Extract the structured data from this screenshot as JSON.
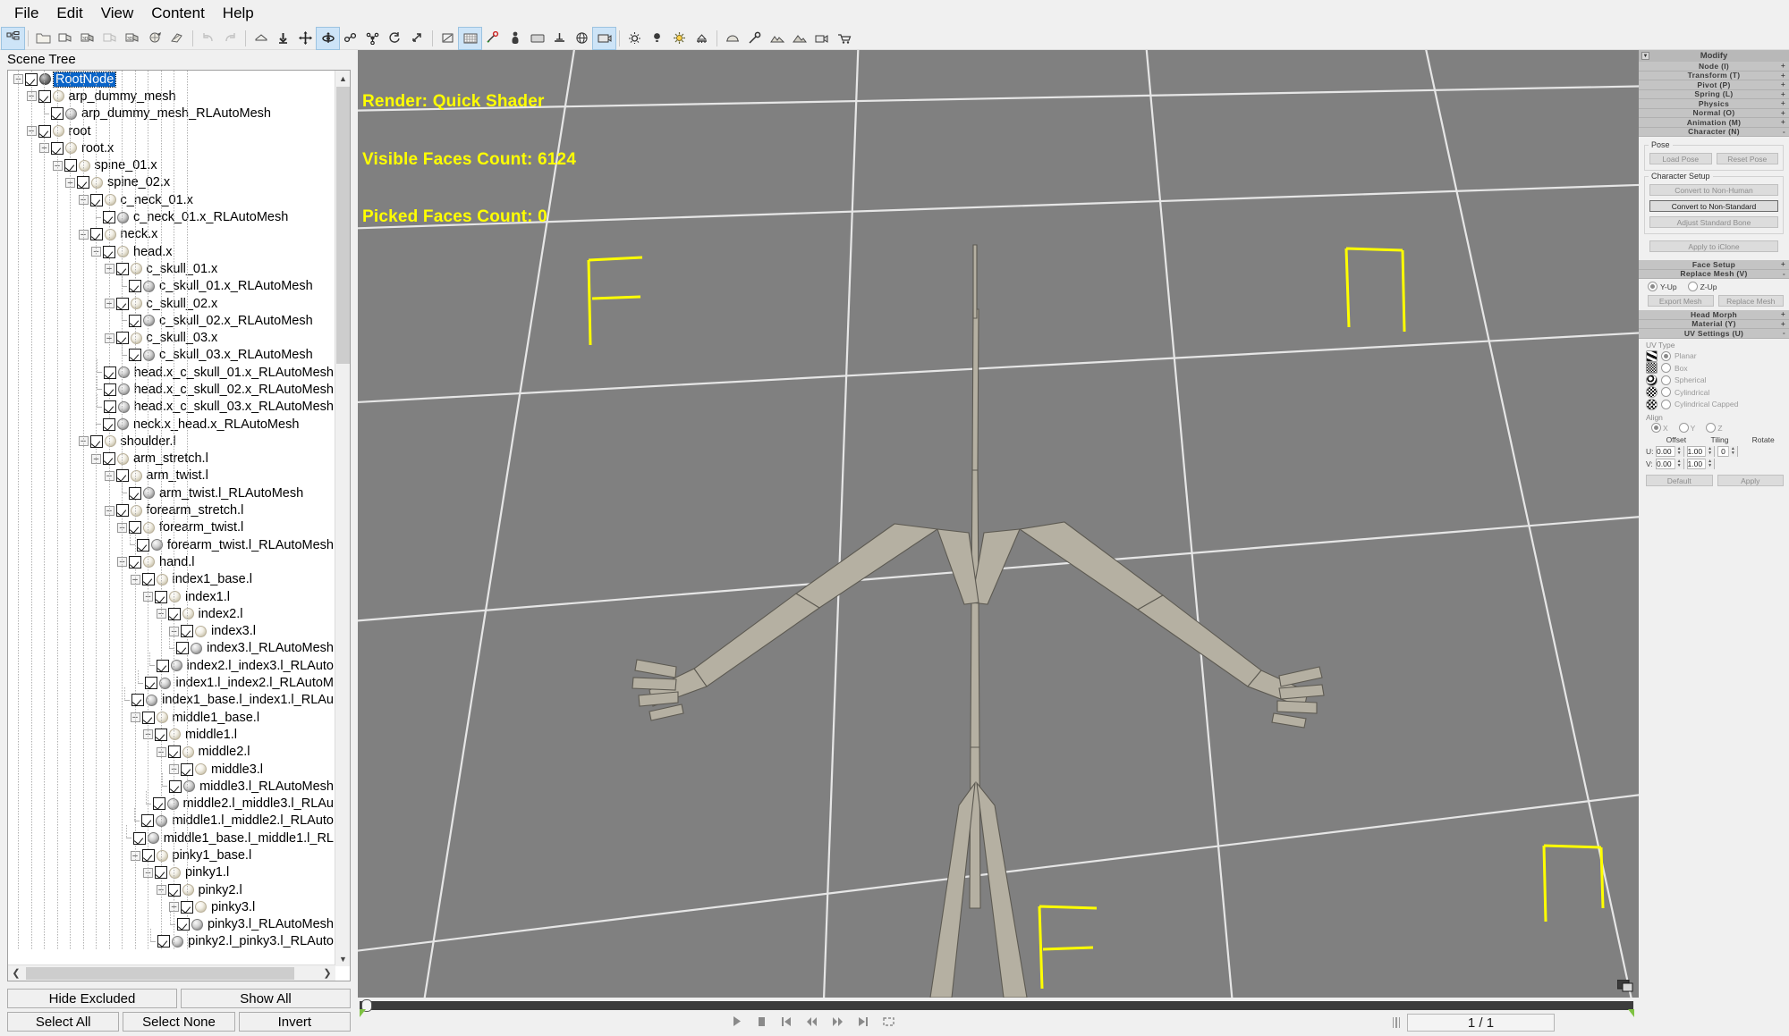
{
  "menu": {
    "items": [
      "File",
      "Edit",
      "View",
      "Content",
      "Help"
    ]
  },
  "toolbar": {
    "groups": [
      {
        "items": [
          {
            "name": "scene-tree-toggle-icon",
            "state": "active"
          }
        ]
      },
      {
        "items": [
          {
            "name": "open-folder-icon",
            "state": "normal"
          },
          {
            "name": "import-fbx-icon",
            "state": "normal"
          },
          {
            "name": "import-obj-icon",
            "state": "normal"
          },
          {
            "name": "import-bvh-icon",
            "state": "disabled"
          },
          {
            "name": "import-3ds-icon",
            "state": "normal"
          },
          {
            "name": "export-model-icon",
            "state": "normal"
          },
          {
            "name": "export-motion-icon",
            "state": "normal"
          }
        ]
      },
      {
        "items": [
          {
            "name": "undo-icon",
            "state": "disabled"
          },
          {
            "name": "redo-icon",
            "state": "disabled"
          }
        ]
      },
      {
        "items": [
          {
            "name": "home-view-icon",
            "state": "normal"
          },
          {
            "name": "drop-to-floor-icon",
            "state": "normal"
          },
          {
            "name": "move-tool-icon",
            "state": "normal"
          },
          {
            "name": "rotate-tool-icon",
            "state": "active"
          },
          {
            "name": "scale-tool-icon",
            "state": "normal"
          },
          {
            "name": "uniform-scale-icon",
            "state": "normal"
          },
          {
            "name": "reset-transform-icon",
            "state": "normal"
          },
          {
            "name": "maximize-view-icon",
            "state": "normal"
          }
        ]
      },
      {
        "items": [
          {
            "name": "wireframe-icon",
            "state": "normal"
          },
          {
            "name": "grid-toggle-icon",
            "state": "active"
          },
          {
            "name": "bone-display-icon",
            "state": "normal"
          },
          {
            "name": "character-icon",
            "state": "normal"
          },
          {
            "name": "background-icon",
            "state": "normal"
          },
          {
            "name": "ground-shadow-icon",
            "state": "normal"
          },
          {
            "name": "sphere-preview-icon",
            "state": "normal"
          },
          {
            "name": "preview-camera-icon",
            "state": "active"
          }
        ]
      },
      {
        "items": [
          {
            "name": "ambient-light-icon",
            "state": "normal"
          },
          {
            "name": "point-light-icon",
            "state": "normal"
          },
          {
            "name": "spot-light-icon",
            "state": "normal"
          },
          {
            "name": "ibl-light-icon",
            "state": "normal"
          }
        ]
      },
      {
        "items": [
          {
            "name": "props-icon",
            "state": "normal"
          },
          {
            "name": "tools-icon",
            "state": "normal"
          },
          {
            "name": "terrain-icon",
            "state": "normal"
          },
          {
            "name": "terrain2-icon",
            "state": "normal"
          },
          {
            "name": "camera-icon",
            "state": "normal"
          },
          {
            "name": "shopping-cart-icon",
            "state": "normal"
          }
        ]
      }
    ]
  },
  "scene_tree": {
    "title": "Scene Tree",
    "selected": "RootNode",
    "nodes": [
      {
        "label": "RootNode",
        "depth": 0,
        "icon": "root",
        "expander": "minus",
        "selected": true,
        "checked": true
      },
      {
        "label": "arp_dummy_mesh",
        "depth": 1,
        "icon": "bone",
        "expander": "minus",
        "checked": true
      },
      {
        "label": "arp_dummy_mesh_RLAutoMesh",
        "depth": 2,
        "icon": "mesh",
        "expander": "leaf",
        "checked": true
      },
      {
        "label": "root",
        "depth": 1,
        "icon": "bone",
        "expander": "minus",
        "checked": true
      },
      {
        "label": "root.x",
        "depth": 2,
        "icon": "bone",
        "expander": "minus",
        "checked": true
      },
      {
        "label": "spine_01.x",
        "depth": 3,
        "icon": "bone",
        "expander": "minus",
        "checked": true
      },
      {
        "label": "spine_02.x",
        "depth": 4,
        "icon": "bone",
        "expander": "minus",
        "checked": true
      },
      {
        "label": "c_neck_01.x",
        "depth": 5,
        "icon": "bone",
        "expander": "minus",
        "checked": true
      },
      {
        "label": "c_neck_01.x_RLAutoMesh",
        "depth": 6,
        "icon": "mesh",
        "expander": "leaf",
        "checked": true
      },
      {
        "label": "neck.x",
        "depth": 5,
        "icon": "bone",
        "expander": "minus",
        "checked": true
      },
      {
        "label": "head.x",
        "depth": 6,
        "icon": "bone",
        "expander": "minus",
        "checked": true
      },
      {
        "label": "c_skull_01.x",
        "depth": 7,
        "icon": "bone",
        "expander": "minus",
        "checked": true
      },
      {
        "label": "c_skull_01.x_RLAutoMesh",
        "depth": 8,
        "icon": "mesh",
        "expander": "leaf",
        "checked": true
      },
      {
        "label": "c_skull_02.x",
        "depth": 7,
        "icon": "bone",
        "expander": "minus",
        "checked": true
      },
      {
        "label": "c_skull_02.x_RLAutoMesh",
        "depth": 8,
        "icon": "mesh",
        "expander": "leaf",
        "checked": true
      },
      {
        "label": "c_skull_03.x",
        "depth": 7,
        "icon": "bone",
        "expander": "minus",
        "checked": true
      },
      {
        "label": "c_skull_03.x_RLAutoMesh",
        "depth": 8,
        "icon": "mesh",
        "expander": "leaf",
        "checked": true
      },
      {
        "label": "head.x_c_skull_01.x_RLAutoMesh",
        "depth": 7,
        "icon": "mesh",
        "expander": "leaf",
        "checked": true
      },
      {
        "label": "head.x_c_skull_02.x_RLAutoMesh",
        "depth": 7,
        "icon": "mesh",
        "expander": "leaf",
        "checked": true
      },
      {
        "label": "head.x_c_skull_03.x_RLAutoMesh",
        "depth": 7,
        "icon": "mesh",
        "expander": "leaf",
        "checked": true
      },
      {
        "label": "neck.x_head.x_RLAutoMesh",
        "depth": 6,
        "icon": "mesh",
        "expander": "leaf",
        "checked": true
      },
      {
        "label": "shoulder.l",
        "depth": 5,
        "icon": "bone",
        "expander": "minus",
        "checked": true
      },
      {
        "label": "arm_stretch.l",
        "depth": 6,
        "icon": "bone",
        "expander": "minus",
        "checked": true
      },
      {
        "label": "arm_twist.l",
        "depth": 7,
        "icon": "bone",
        "expander": "minus",
        "checked": true
      },
      {
        "label": "arm_twist.l_RLAutoMesh",
        "depth": 8,
        "icon": "mesh",
        "expander": "leaf",
        "checked": true
      },
      {
        "label": "forearm_stretch.l",
        "depth": 7,
        "icon": "bone",
        "expander": "minus",
        "checked": true
      },
      {
        "label": "forearm_twist.l",
        "depth": 8,
        "icon": "bone",
        "expander": "minus",
        "checked": true
      },
      {
        "label": "forearm_twist.l_RLAutoMesh",
        "depth": 9,
        "icon": "mesh",
        "expander": "leaf",
        "checked": true
      },
      {
        "label": "hand.l",
        "depth": 8,
        "icon": "bone",
        "expander": "minus",
        "checked": true
      },
      {
        "label": "index1_base.l",
        "depth": 9,
        "icon": "bone",
        "expander": "minus",
        "checked": true
      },
      {
        "label": "index1.l",
        "depth": 10,
        "icon": "bone",
        "expander": "minus",
        "checked": true
      },
      {
        "label": "index2.l",
        "depth": 11,
        "icon": "bone",
        "expander": "minus",
        "checked": true
      },
      {
        "label": "index3.l",
        "depth": 12,
        "icon": "bone",
        "expander": "minus",
        "checked": true
      },
      {
        "label": "index3.l_RLAutoMesh",
        "depth": 13,
        "icon": "mesh",
        "expander": "leaf",
        "checked": true
      },
      {
        "label": "index2.l_index3.l_RLAuto",
        "depth": 12,
        "icon": "mesh",
        "expander": "leaf",
        "checked": true
      },
      {
        "label": "index1.l_index2.l_RLAutoM",
        "depth": 11,
        "icon": "mesh",
        "expander": "leaf",
        "checked": true
      },
      {
        "label": "index1_base.l_index1.l_RLAu",
        "depth": 10,
        "icon": "mesh",
        "expander": "leaf",
        "checked": true
      },
      {
        "label": "middle1_base.l",
        "depth": 9,
        "icon": "bone",
        "expander": "minus",
        "checked": true
      },
      {
        "label": "middle1.l",
        "depth": 10,
        "icon": "bone",
        "expander": "minus",
        "checked": true
      },
      {
        "label": "middle2.l",
        "depth": 11,
        "icon": "bone",
        "expander": "minus",
        "checked": true
      },
      {
        "label": "middle3.l",
        "depth": 12,
        "icon": "bone",
        "expander": "minus",
        "checked": true
      },
      {
        "label": "middle3.l_RLAutoMesh",
        "depth": 13,
        "icon": "mesh",
        "expander": "leaf",
        "checked": true
      },
      {
        "label": "middle2.l_middle3.l_RLAu",
        "depth": 12,
        "icon": "mesh",
        "expander": "leaf",
        "checked": true
      },
      {
        "label": "middle1.l_middle2.l_RLAuto",
        "depth": 11,
        "icon": "mesh",
        "expander": "leaf",
        "checked": true
      },
      {
        "label": "middle1_base.l_middle1.l_RL",
        "depth": 10,
        "icon": "mesh",
        "expander": "leaf",
        "checked": true
      },
      {
        "label": "pinky1_base.l",
        "depth": 9,
        "icon": "bone",
        "expander": "minus",
        "checked": true
      },
      {
        "label": "pinky1.l",
        "depth": 10,
        "icon": "bone",
        "expander": "minus",
        "checked": true
      },
      {
        "label": "pinky2.l",
        "depth": 11,
        "icon": "bone",
        "expander": "minus",
        "checked": true
      },
      {
        "label": "pinky3.l",
        "depth": 12,
        "icon": "bone",
        "expander": "minus",
        "checked": true
      },
      {
        "label": "pinky3.l_RLAutoMesh",
        "depth": 13,
        "icon": "mesh",
        "expander": "leaf",
        "checked": true
      },
      {
        "label": "pinky2.l_pinky3.l_RLAuto",
        "depth": 12,
        "icon": "mesh",
        "expander": "leaf",
        "checked": true
      }
    ],
    "buttons": {
      "hide_excluded": "Hide Excluded",
      "show_all": "Show All",
      "select_all": "Select All",
      "select_none": "Select None",
      "invert": "Invert"
    }
  },
  "viewport": {
    "overlay": {
      "render_label": "Render:",
      "render_value": "Quick Shader",
      "visible_faces_label": "Visible Faces Count:",
      "visible_faces_value": "6124",
      "picked_faces_label": "Picked Faces Count:",
      "picked_faces_value": "0"
    },
    "overlay_color": "#ffff00",
    "background_color": "#808080",
    "grid_color": "#e8e8e8",
    "gizmo_color": "#ffff00"
  },
  "modify_panel": {
    "title": "Modify",
    "rollups": [
      {
        "label": "Node (I)",
        "sign": "+"
      },
      {
        "label": "Transform (T)",
        "sign": "+"
      },
      {
        "label": "Pivot (P)",
        "sign": "+"
      },
      {
        "label": "Spring (L)",
        "sign": "+"
      },
      {
        "label": "Physics",
        "sign": "+"
      },
      {
        "label": "Normal (O)",
        "sign": "+"
      },
      {
        "label": "Animation (M)",
        "sign": "+"
      },
      {
        "label": "Character (N)",
        "sign": "-"
      }
    ],
    "pose": {
      "group_title": "Pose",
      "load_pose": "Load Pose",
      "reset_pose": "Reset Pose"
    },
    "character_setup": {
      "group_title": "Character Setup",
      "convert_to_non_human": "Convert to Non-Human",
      "convert_to_non_standard": "Convert to Non-Standard",
      "adjust_standard_bone": "Adjust Standard Bone",
      "apply_to_iclone": "Apply to iClone"
    },
    "face_setup": {
      "label": "Face Setup",
      "sign": "+"
    },
    "replace_mesh": {
      "label": "Replace Mesh (V)",
      "sign": "-",
      "axis_options": [
        {
          "label": "Y-Up",
          "selected": true
        },
        {
          "label": "Z-Up",
          "selected": false
        }
      ],
      "export_mesh": "Export Mesh",
      "replace_mesh": "Replace Mesh"
    },
    "head_morph": {
      "label": "Head Morph",
      "sign": "+"
    },
    "material": {
      "label": "Material (Y)",
      "sign": "+"
    },
    "uv_settings": {
      "label": "UV Settings (U)",
      "sign": "-",
      "uv_type_label": "UV Type",
      "uv_types": [
        {
          "label": "Planar",
          "selected": true
        },
        {
          "label": "Box",
          "selected": false
        },
        {
          "label": "Spherical",
          "selected": false
        },
        {
          "label": "Cylindrical",
          "selected": false
        },
        {
          "label": "Cylindrical Capped",
          "selected": false
        }
      ],
      "align_label": "Align",
      "align_options": [
        {
          "label": "X",
          "selected": true
        },
        {
          "label": "Y",
          "selected": false
        },
        {
          "label": "Z",
          "selected": false
        }
      ],
      "columns": {
        "offset": "Offset",
        "tiling": "Tiling",
        "rotate": "Rotate"
      },
      "rows": [
        {
          "axis": "U:",
          "offset": "0.00",
          "tiling": "1.00",
          "rotate": "0"
        },
        {
          "axis": "V:",
          "offset": "0.00",
          "tiling": "1.00",
          "rotate": ""
        }
      ],
      "default_button": "Default",
      "apply_button": "Apply"
    }
  },
  "timeline": {
    "transport": [
      "play-icon",
      "stop-icon",
      "first-frame-icon",
      "prev-frame-icon",
      "next-frame-icon",
      "last-frame-icon",
      "loop-icon"
    ],
    "frame_display": "1 / 1"
  }
}
